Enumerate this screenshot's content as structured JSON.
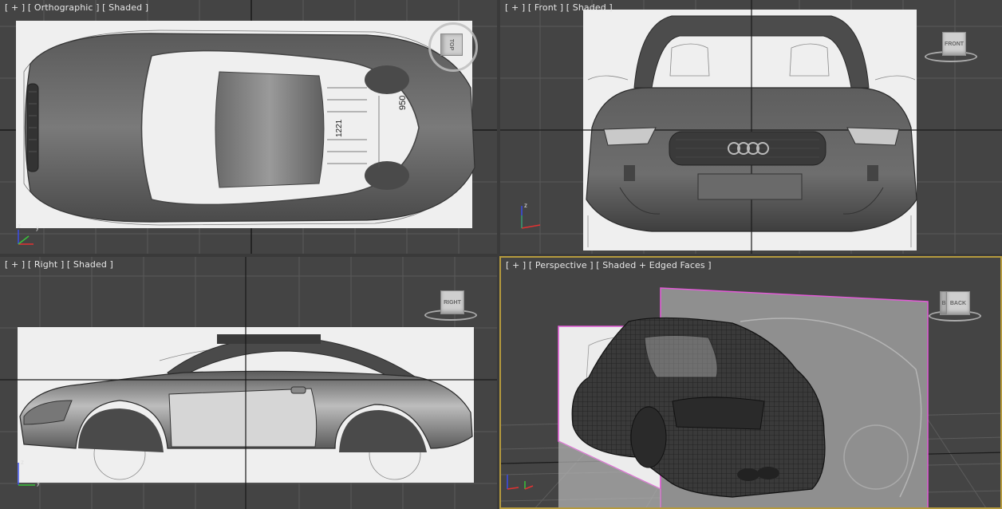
{
  "viewports": {
    "top": {
      "label": "[ + ] [ Orthographic ] [ Shaded ]",
      "cube": "TOP"
    },
    "front": {
      "label": "[ + ] [ Front ] [ Shaded ]",
      "cube": "FRONT"
    },
    "right": {
      "label": "[ + ] [ Right ] [ Shaded ]",
      "cube": "RIGHT"
    },
    "perspective": {
      "label": "[ + ] [ Perspective ] [ Shaded + Edged Faces ]",
      "cube": "BACK",
      "cube_side": "B"
    }
  },
  "blueprint": {
    "dim_950": "950",
    "dim_1221": "1221"
  },
  "axes": {
    "x": "x",
    "y": "y",
    "z": "z"
  },
  "colors": {
    "active_border": "#b59a3e",
    "section_plane": "#e35bd8",
    "axis_x": "#e23232",
    "axis_y": "#3ac23a",
    "axis_z": "#3b4de8"
  }
}
